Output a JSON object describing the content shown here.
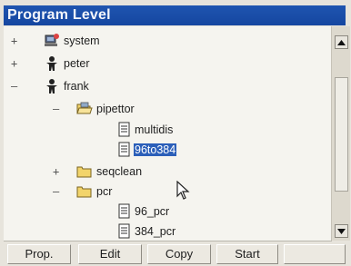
{
  "window": {
    "title": "Program Level"
  },
  "tree": {
    "nodes": [
      {
        "expander": "+",
        "label": "system",
        "icon": "system-computer-icon"
      },
      {
        "expander": "+",
        "label": "peter",
        "icon": "user-icon"
      },
      {
        "expander": "–",
        "label": "frank",
        "icon": "user-icon"
      },
      {
        "expander": "–",
        "label": "pipettor",
        "icon": "open-folder-icon"
      },
      {
        "expander": "",
        "label": "multidis",
        "icon": "document-icon"
      },
      {
        "expander": "",
        "label": "96to384",
        "icon": "document-icon",
        "selected": true
      },
      {
        "expander": "+",
        "label": "seqclean",
        "icon": "folder-icon"
      },
      {
        "expander": "–",
        "label": "pcr",
        "icon": "folder-icon"
      },
      {
        "expander": "",
        "label": "96_pcr",
        "icon": "document-icon"
      },
      {
        "expander": "",
        "label": "384_pcr",
        "icon": "document-icon"
      }
    ]
  },
  "buttons": {
    "prop": "Prop.",
    "edit": "Edit",
    "copy": "Copy",
    "start": "Start",
    "blank": ""
  },
  "colors": {
    "titlebar": "#1b4fa8",
    "selection": "#2b5fb9",
    "background": "#e7e4dc"
  }
}
